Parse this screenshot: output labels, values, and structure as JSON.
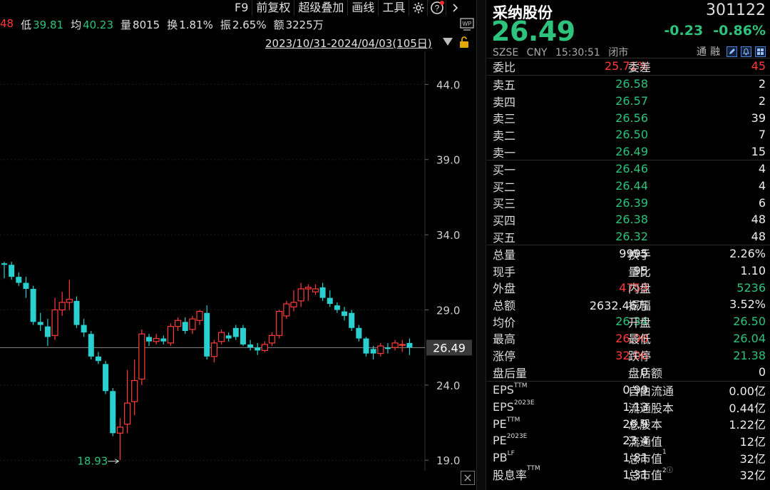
{
  "toolbar": {
    "items": [
      "F9",
      "前复权",
      "超级叠加",
      "画线",
      "工具"
    ],
    "gear": "gear-icon",
    "help": "help-icon",
    "nav_right": "chevron-right-icon"
  },
  "info_bar": {
    "high_frag": "48",
    "low_label": "低",
    "low": "39.81",
    "avg_label": "均",
    "avg": "40.23",
    "vol_label": "量",
    "vol": "8015",
    "turn_label": "换",
    "turn": "1.81%",
    "amp_label": "振",
    "amp": "2.65%",
    "amt_label": "额",
    "amt": "3225万"
  },
  "range_text": "2023/10/31-2024/04/03(105日)",
  "wp_label": "WP",
  "chart_data": {
    "type": "candlestick",
    "y_ticks": [
      44.0,
      39.0,
      34.0,
      29.0,
      24.0,
      19.0
    ],
    "y_tick_labels": [
      "44.0",
      "39.0",
      "34.0",
      "29.0",
      "24.0",
      "19.0"
    ],
    "ylim": [
      18.3,
      46.2
    ],
    "current_price": 26.49,
    "current_label": "26.49",
    "low_marker": {
      "value": 18.93,
      "label": "18.93"
    },
    "up_color": "#ff3b3b",
    "down_color": "#2ad0cf",
    "candles": [
      [
        32.1,
        32.0,
        32.2,
        31.1
      ],
      [
        32.0,
        31.2,
        32.2,
        31.0
      ],
      [
        31.2,
        30.8,
        31.5,
        30.6
      ],
      [
        30.8,
        30.4,
        31.2,
        29.8
      ],
      [
        30.4,
        28.2,
        30.6,
        28.0
      ],
      [
        28.2,
        28.0,
        28.8,
        27.6
      ],
      [
        27.9,
        27.2,
        28.4,
        26.6
      ],
      [
        27.3,
        29.0,
        29.8,
        27.0
      ],
      [
        29.0,
        29.5,
        30.2,
        28.6
      ],
      [
        29.5,
        29.7,
        31.0,
        29.0
      ],
      [
        29.6,
        28.0,
        29.9,
        27.8
      ],
      [
        28.0,
        27.5,
        28.4,
        27.2
      ],
      [
        27.4,
        25.9,
        27.6,
        25.7
      ],
      [
        25.9,
        25.6,
        26.2,
        25.4
      ],
      [
        25.4,
        23.6,
        25.6,
        23.4
      ],
      [
        23.6,
        20.8,
        23.8,
        20.6
      ],
      [
        20.8,
        21.2,
        21.8,
        19.0
      ],
      [
        21.4,
        22.8,
        25.0,
        20.8
      ],
      [
        22.9,
        24.3,
        25.7,
        22.0
      ],
      [
        24.4,
        27.4,
        27.7,
        24.0
      ],
      [
        27.2,
        26.9,
        27.4,
        26.6
      ],
      [
        26.9,
        27.1,
        27.4,
        26.7
      ],
      [
        27.1,
        26.9,
        27.3,
        26.7
      ],
      [
        26.8,
        27.9,
        28.1,
        26.6
      ],
      [
        27.9,
        28.3,
        28.5,
        27.6
      ],
      [
        28.2,
        27.6,
        28.5,
        27.4
      ],
      [
        27.7,
        28.4,
        28.6,
        27.4
      ],
      [
        28.3,
        28.9,
        29.0,
        28.0
      ],
      [
        28.8,
        25.9,
        29.3,
        25.7
      ],
      [
        25.9,
        26.8,
        27.0,
        25.5
      ],
      [
        26.9,
        27.5,
        27.7,
        26.7
      ],
      [
        27.3,
        27.1,
        27.5,
        26.9
      ],
      [
        27.8,
        27.2,
        28.0,
        27.0
      ],
      [
        27.8,
        26.7,
        28.0,
        26.6
      ],
      [
        26.7,
        26.5,
        27.0,
        26.3
      ],
      [
        26.5,
        26.3,
        26.8,
        26.0
      ],
      [
        26.3,
        26.7,
        26.9,
        26.2
      ],
      [
        26.8,
        27.3,
        27.5,
        26.6
      ],
      [
        27.3,
        28.9,
        29.0,
        27.1
      ],
      [
        28.6,
        29.4,
        29.6,
        28.4
      ],
      [
        29.2,
        29.5,
        30.3,
        28.9
      ],
      [
        29.6,
        30.4,
        30.8,
        29.2
      ],
      [
        30.4,
        30.5,
        30.7,
        29.6
      ],
      [
        30.2,
        30.4,
        30.7,
        30.0
      ],
      [
        30.5,
        29.8,
        30.8,
        29.6
      ],
      [
        29.8,
        29.4,
        30.3,
        29.2
      ],
      [
        29.3,
        29.0,
        29.5,
        28.8
      ],
      [
        28.9,
        28.6,
        29.2,
        28.3
      ],
      [
        28.8,
        27.8,
        29.0,
        27.6
      ],
      [
        27.8,
        27.1,
        28.0,
        26.9
      ],
      [
        27.1,
        26.1,
        27.2,
        25.9
      ],
      [
        26.4,
        26.1,
        26.6,
        25.7
      ],
      [
        26.1,
        26.6,
        26.8,
        25.9
      ],
      [
        26.5,
        26.4,
        26.8,
        26.1
      ],
      [
        26.5,
        26.8,
        27.0,
        26.3
      ],
      [
        26.7,
        26.7,
        27.0,
        26.2
      ],
      [
        26.8,
        26.5,
        27.1,
        26.0
      ]
    ]
  },
  "quote": {
    "name": "采纳股份",
    "code": "301122",
    "price": "26.49",
    "change": "-0.23",
    "change_pct": "-0.86%",
    "exchange": "SZSE",
    "currency": "CNY",
    "time": "15:30:51",
    "status": "闭市",
    "tag_tong": "通",
    "tag_rong": "融",
    "weibi_label": "委比",
    "weibi": "25.71%",
    "weicha_label": "委差",
    "weicha": "45",
    "sell": [
      {
        "label": "卖五",
        "price": "26.58",
        "vol": "2"
      },
      {
        "label": "卖四",
        "price": "26.57",
        "vol": "2"
      },
      {
        "label": "卖三",
        "price": "26.56",
        "vol": "39"
      },
      {
        "label": "卖二",
        "price": "26.50",
        "vol": "7"
      },
      {
        "label": "卖一",
        "price": "26.49",
        "vol": "15"
      }
    ],
    "buy": [
      {
        "label": "买一",
        "price": "26.46",
        "vol": "4"
      },
      {
        "label": "买二",
        "price": "26.44",
        "vol": "4"
      },
      {
        "label": "买三",
        "price": "26.39",
        "vol": "6"
      },
      {
        "label": "买四",
        "price": "26.38",
        "vol": "48"
      },
      {
        "label": "买五",
        "price": "26.32",
        "vol": "48"
      }
    ],
    "stats": [
      {
        "l1": "总量",
        "v1": "9995",
        "c1": "wht",
        "l2": "换手",
        "v2": "2.26%",
        "c2": "wht"
      },
      {
        "l1": "现手",
        "v1": "95",
        "c1": "wht",
        "l2": "量比",
        "v2": "1.10",
        "c2": "wht"
      },
      {
        "l1": "外盘",
        "v1": "4759",
        "c1": "red",
        "l2": "内盘",
        "v2": "5236",
        "c2": "green"
      },
      {
        "l1": "总额",
        "v1": "2632.46万",
        "c1": "wht",
        "l2": "振幅",
        "v2": "3.52%",
        "c2": "wht"
      },
      {
        "l1": "均价",
        "v1": "26.34",
        "c1": "green",
        "l2": "开盘",
        "v2": "26.50",
        "c2": "green"
      },
      {
        "l1": "最高",
        "v1": "26.98",
        "c1": "red",
        "l2": "最低",
        "v2": "26.04",
        "c2": "green"
      },
      {
        "l1": "涨停",
        "v1": "32.06",
        "c1": "red",
        "l2": "跌停",
        "v2": "21.38",
        "c2": "green"
      },
      {
        "l1": "盘后量",
        "v1": "0",
        "c1": "wht",
        "l2": "盘后额",
        "v2": "0",
        "c2": "wht"
      }
    ],
    "fund": [
      {
        "l1": "EPS",
        "s1": "TTM",
        "v1": "0.99",
        "l2": "自由流通",
        "s2": "",
        "v2": "0.00亿"
      },
      {
        "l1": "EPS",
        "s1": "2023E",
        "v1": "1.13",
        "l2": "流通股本",
        "s2": "",
        "v2": "0.44亿"
      },
      {
        "l1": "PE",
        "s1": "TTM",
        "v1": "26.9",
        "l2": "总股本",
        "s2": "",
        "v2": "1.22亿"
      },
      {
        "l1": "PE",
        "s1": "2023E",
        "v1": "23.4",
        "l2": "流通值",
        "s2": "",
        "v2": "12亿"
      },
      {
        "l1": "PB",
        "s1": "LF",
        "v1": "1.81",
        "l2": "总市值",
        "s2": "1",
        "v2": "32亿"
      },
      {
        "l1": "股息率",
        "s1": "TTM",
        "v1": "1.31",
        "l2": "总市值",
        "s2": "2ⓘ",
        "v2": "32亿"
      }
    ]
  }
}
